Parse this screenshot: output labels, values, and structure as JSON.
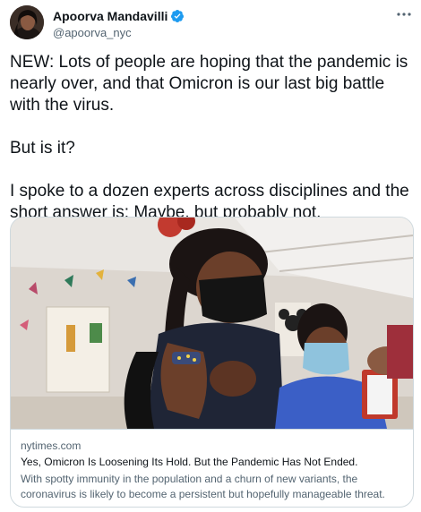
{
  "author": {
    "display_name": "Apoorva Mandavilli",
    "handle": "@apoorva_nyc",
    "verified_icon": "verified-badge-icon",
    "verified_color": "#1d9bf0"
  },
  "more_icon": "more-options-icon",
  "tweet": {
    "paragraphs": [
      "NEW: Lots of people are hoping that the pandemic is nearly over, and that Omicron is our last big battle with the virus.",
      "But is it?",
      "I spoke to a dozen experts across disciplines and the short answer is: Maybe, but probably not."
    ]
  },
  "link_card": {
    "domain": "nytimes.com",
    "title": "Yes, Omicron Is Loosening Its Hold. But the Pandemic Has Not Ended.",
    "description": "With spotty immunity in the population and a churn of new variants, the coronavirus is likely to become a persistent but hopefully manageable threat."
  },
  "colors": {
    "text": "#0f1419",
    "secondary": "#536471",
    "border": "#cfd9de"
  }
}
